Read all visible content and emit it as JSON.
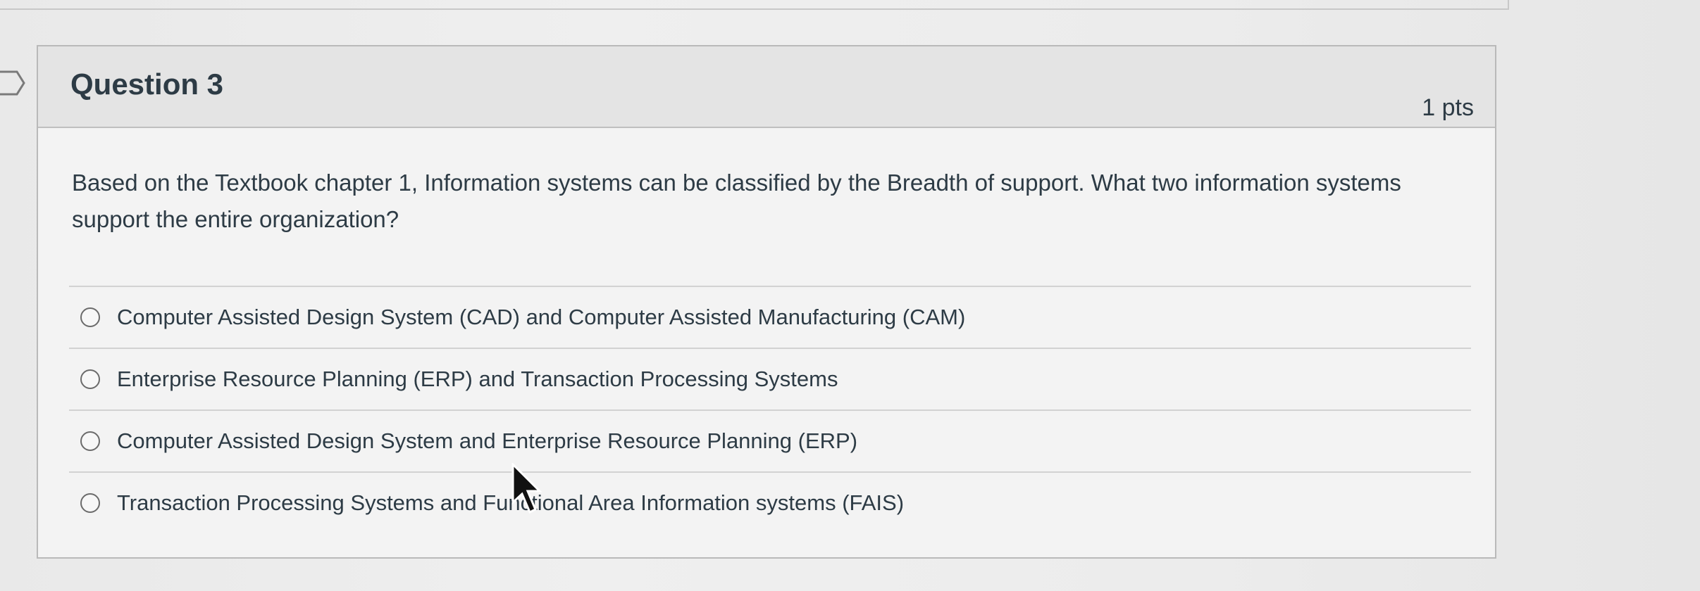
{
  "question": {
    "title": "Question 3",
    "points": "1 pts",
    "prompt": "Based on the Textbook chapter 1, Information systems can be classified by the Breadth of support.  What two information systems support the entire organization?"
  },
  "answers": [
    {
      "label": "Computer Assisted Design System (CAD)  and  Computer Assisted Manufacturing (CAM)"
    },
    {
      "label": "Enterprise Resource Planning (ERP) and Transaction Processing Systems"
    },
    {
      "label": "Computer Assisted Design System and Enterprise Resource Planning (ERP)"
    },
    {
      "label": "Transaction Processing Systems and Functional Area Information systems (FAIS)"
    }
  ],
  "icons": {
    "flag": "flag-icon",
    "cursor": "mouse-cursor-icon"
  }
}
